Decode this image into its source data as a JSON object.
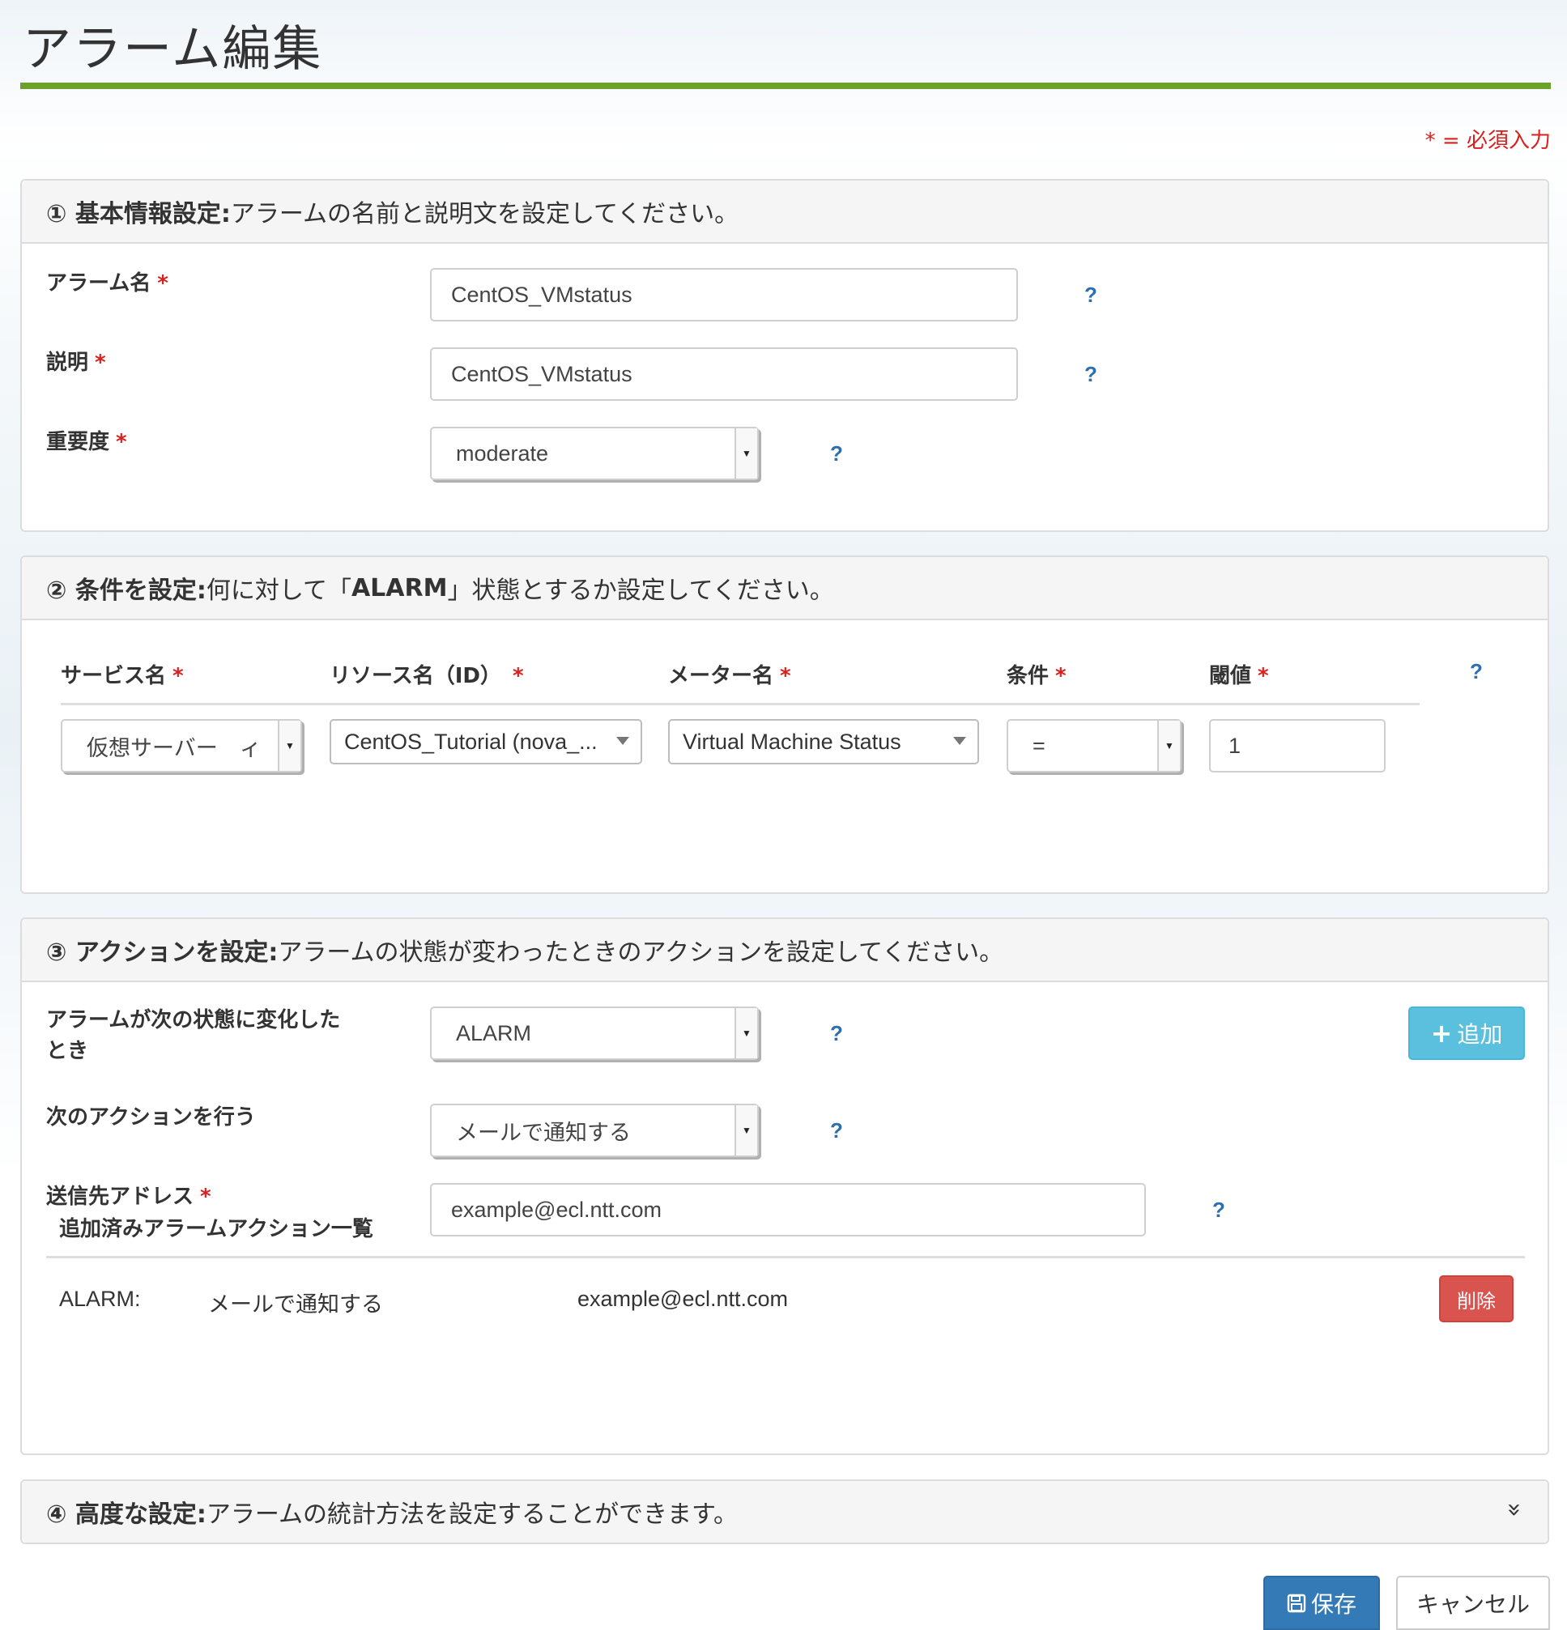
{
  "page": {
    "title": "アラーム編集",
    "required_note": "* = 必須入力"
  },
  "section1": {
    "heading_bold": "① 基本情報設定:",
    "heading_text": " アラームの名前と説明文を設定してください。",
    "name_label": "アラーム名",
    "name_value": "CentOS_VMstatus",
    "desc_label": "説明",
    "desc_value": "CentOS_VMstatus",
    "severity_label": "重要度",
    "severity_value": "moderate"
  },
  "section2": {
    "heading_bold": "② 条件を設定:",
    "heading_text_pre": " 何に対して「",
    "heading_text_bold": "ALARM",
    "heading_text_post": "」状態とするか設定してください。",
    "columns": {
      "service": "サービス名",
      "resource": "リソース名（ID）",
      "meter": "メーター名",
      "condition": "条件",
      "threshold": "閾値"
    },
    "service_value": "仮想サーバー　ィ",
    "resource_value": "CentOS_Tutorial (nova_...",
    "meter_value": "Virtual Machine Status",
    "condition_value": "=",
    "threshold_value": "1"
  },
  "section3": {
    "heading_bold": "③ アクションを設定:",
    "heading_text": " アラームの状態が変わったときのアクションを設定してください。",
    "state_label_line1": "アラームが次の状態に変化した",
    "state_label_line2": "とき",
    "state_value": "ALARM",
    "action_label": "次のアクションを行う",
    "action_value": "メールで通知する",
    "address_label": "送信先アドレス",
    "address_value": "example@ecl.ntt.com",
    "add_button": "追加",
    "list_title": "追加済みアラームアクション一覧",
    "actions": [
      {
        "state": "ALARM:",
        "action": "メールで通知する",
        "address": "example@ecl.ntt.com"
      }
    ],
    "delete_button": "削除"
  },
  "section4": {
    "heading_bold": "④ 高度な設定:",
    "heading_text": " アラームの統計方法を設定することができます。"
  },
  "footer": {
    "save_button": "保存",
    "cancel_button": "キャンセル"
  },
  "common": {
    "required_mark": "*",
    "help": "?",
    "select_arrow": "▼",
    "collapse_chevron": "»"
  },
  "colors": {
    "accent_green": "#6aa22a",
    "primary": "#337ab7",
    "info": "#5bc0de",
    "danger": "#d9534f",
    "required": "#d9201f",
    "help": "#2a6fb0"
  }
}
